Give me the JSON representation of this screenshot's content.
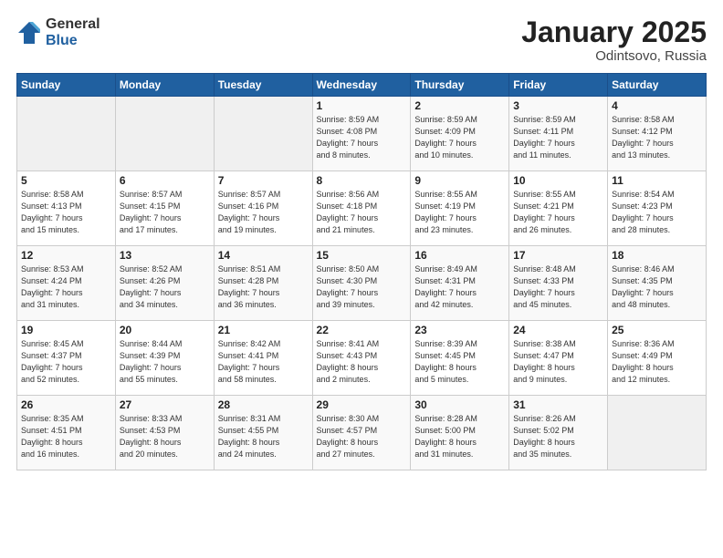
{
  "logo": {
    "general": "General",
    "blue": "Blue"
  },
  "title": "January 2025",
  "subtitle": "Odintsovo, Russia",
  "days_header": [
    "Sunday",
    "Monday",
    "Tuesday",
    "Wednesday",
    "Thursday",
    "Friday",
    "Saturday"
  ],
  "weeks": [
    [
      {
        "day": "",
        "info": ""
      },
      {
        "day": "",
        "info": ""
      },
      {
        "day": "",
        "info": ""
      },
      {
        "day": "1",
        "info": "Sunrise: 8:59 AM\nSunset: 4:08 PM\nDaylight: 7 hours\nand 8 minutes."
      },
      {
        "day": "2",
        "info": "Sunrise: 8:59 AM\nSunset: 4:09 PM\nDaylight: 7 hours\nand 10 minutes."
      },
      {
        "day": "3",
        "info": "Sunrise: 8:59 AM\nSunset: 4:11 PM\nDaylight: 7 hours\nand 11 minutes."
      },
      {
        "day": "4",
        "info": "Sunrise: 8:58 AM\nSunset: 4:12 PM\nDaylight: 7 hours\nand 13 minutes."
      }
    ],
    [
      {
        "day": "5",
        "info": "Sunrise: 8:58 AM\nSunset: 4:13 PM\nDaylight: 7 hours\nand 15 minutes."
      },
      {
        "day": "6",
        "info": "Sunrise: 8:57 AM\nSunset: 4:15 PM\nDaylight: 7 hours\nand 17 minutes."
      },
      {
        "day": "7",
        "info": "Sunrise: 8:57 AM\nSunset: 4:16 PM\nDaylight: 7 hours\nand 19 minutes."
      },
      {
        "day": "8",
        "info": "Sunrise: 8:56 AM\nSunset: 4:18 PM\nDaylight: 7 hours\nand 21 minutes."
      },
      {
        "day": "9",
        "info": "Sunrise: 8:55 AM\nSunset: 4:19 PM\nDaylight: 7 hours\nand 23 minutes."
      },
      {
        "day": "10",
        "info": "Sunrise: 8:55 AM\nSunset: 4:21 PM\nDaylight: 7 hours\nand 26 minutes."
      },
      {
        "day": "11",
        "info": "Sunrise: 8:54 AM\nSunset: 4:23 PM\nDaylight: 7 hours\nand 28 minutes."
      }
    ],
    [
      {
        "day": "12",
        "info": "Sunrise: 8:53 AM\nSunset: 4:24 PM\nDaylight: 7 hours\nand 31 minutes."
      },
      {
        "day": "13",
        "info": "Sunrise: 8:52 AM\nSunset: 4:26 PM\nDaylight: 7 hours\nand 34 minutes."
      },
      {
        "day": "14",
        "info": "Sunrise: 8:51 AM\nSunset: 4:28 PM\nDaylight: 7 hours\nand 36 minutes."
      },
      {
        "day": "15",
        "info": "Sunrise: 8:50 AM\nSunset: 4:30 PM\nDaylight: 7 hours\nand 39 minutes."
      },
      {
        "day": "16",
        "info": "Sunrise: 8:49 AM\nSunset: 4:31 PM\nDaylight: 7 hours\nand 42 minutes."
      },
      {
        "day": "17",
        "info": "Sunrise: 8:48 AM\nSunset: 4:33 PM\nDaylight: 7 hours\nand 45 minutes."
      },
      {
        "day": "18",
        "info": "Sunrise: 8:46 AM\nSunset: 4:35 PM\nDaylight: 7 hours\nand 48 minutes."
      }
    ],
    [
      {
        "day": "19",
        "info": "Sunrise: 8:45 AM\nSunset: 4:37 PM\nDaylight: 7 hours\nand 52 minutes."
      },
      {
        "day": "20",
        "info": "Sunrise: 8:44 AM\nSunset: 4:39 PM\nDaylight: 7 hours\nand 55 minutes."
      },
      {
        "day": "21",
        "info": "Sunrise: 8:42 AM\nSunset: 4:41 PM\nDaylight: 7 hours\nand 58 minutes."
      },
      {
        "day": "22",
        "info": "Sunrise: 8:41 AM\nSunset: 4:43 PM\nDaylight: 8 hours\nand 2 minutes."
      },
      {
        "day": "23",
        "info": "Sunrise: 8:39 AM\nSunset: 4:45 PM\nDaylight: 8 hours\nand 5 minutes."
      },
      {
        "day": "24",
        "info": "Sunrise: 8:38 AM\nSunset: 4:47 PM\nDaylight: 8 hours\nand 9 minutes."
      },
      {
        "day": "25",
        "info": "Sunrise: 8:36 AM\nSunset: 4:49 PM\nDaylight: 8 hours\nand 12 minutes."
      }
    ],
    [
      {
        "day": "26",
        "info": "Sunrise: 8:35 AM\nSunset: 4:51 PM\nDaylight: 8 hours\nand 16 minutes."
      },
      {
        "day": "27",
        "info": "Sunrise: 8:33 AM\nSunset: 4:53 PM\nDaylight: 8 hours\nand 20 minutes."
      },
      {
        "day": "28",
        "info": "Sunrise: 8:31 AM\nSunset: 4:55 PM\nDaylight: 8 hours\nand 24 minutes."
      },
      {
        "day": "29",
        "info": "Sunrise: 8:30 AM\nSunset: 4:57 PM\nDaylight: 8 hours\nand 27 minutes."
      },
      {
        "day": "30",
        "info": "Sunrise: 8:28 AM\nSunset: 5:00 PM\nDaylight: 8 hours\nand 31 minutes."
      },
      {
        "day": "31",
        "info": "Sunrise: 8:26 AM\nSunset: 5:02 PM\nDaylight: 8 hours\nand 35 minutes."
      },
      {
        "day": "",
        "info": ""
      }
    ]
  ]
}
